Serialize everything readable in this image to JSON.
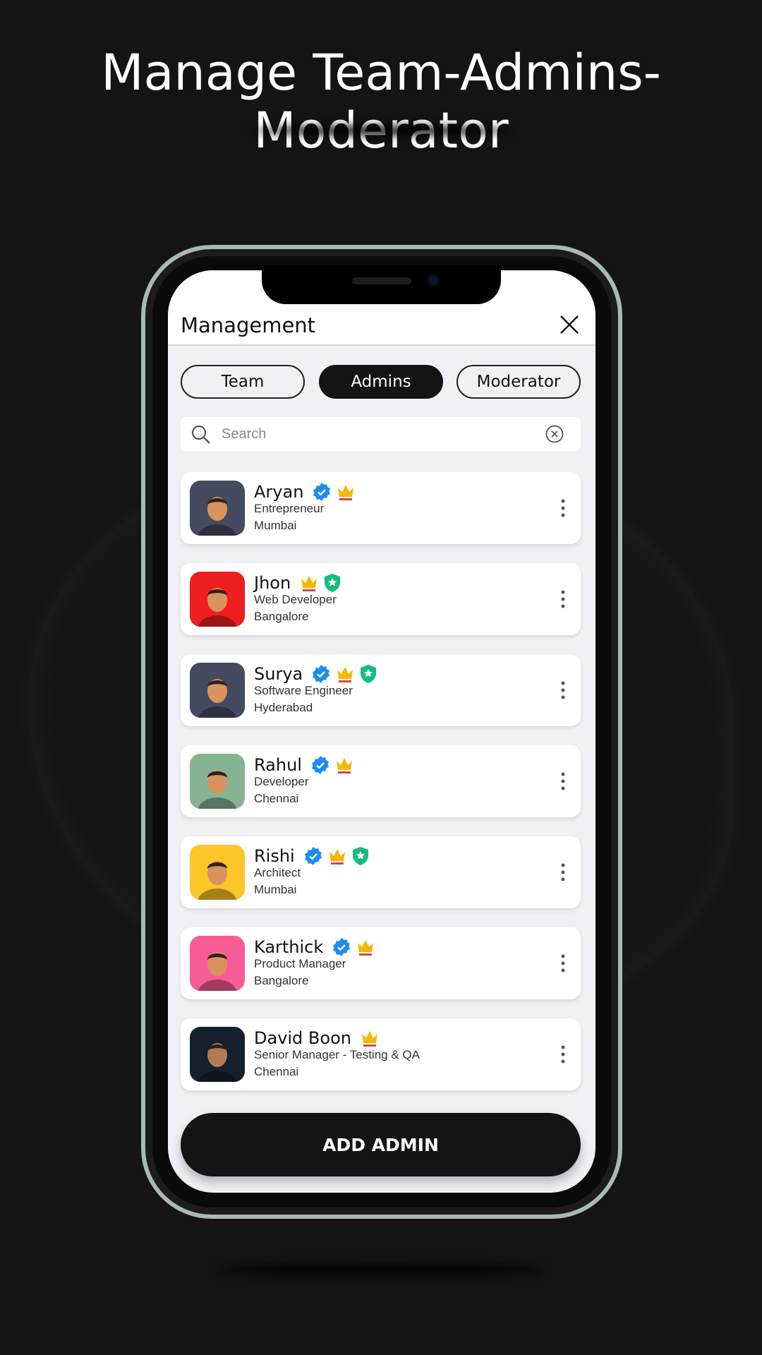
{
  "page_title": "Manage Team-Admins-Moderator",
  "header": {
    "title": "Management",
    "close_icon": "close-icon"
  },
  "tabs": [
    {
      "label": "Team",
      "active": false
    },
    {
      "label": "Admins",
      "active": true
    },
    {
      "label": "Moderator",
      "active": false
    }
  ],
  "search": {
    "placeholder": "Search",
    "value": ""
  },
  "colors": {
    "verified": "#1d8cf2",
    "crown": "#f5b800",
    "crown_bar": "#e0443a",
    "shield": "#16bd7f",
    "dark": "#141414"
  },
  "members": [
    {
      "name": "Aryan",
      "role": "Entrepreneur",
      "city": "Mumbai",
      "badges": [
        "verified",
        "crown"
      ],
      "avatar_bg": "#454b5e"
    },
    {
      "name": "Jhon",
      "role": "Web Developer",
      "city": "Bangalore",
      "badges": [
        "crown",
        "shield"
      ],
      "avatar_bg": "#ee1e1e"
    },
    {
      "name": "Surya",
      "role": "Software Engineer",
      "city": "Hyderabad",
      "badges": [
        "verified",
        "crown",
        "shield"
      ],
      "avatar_bg": "#454b5e"
    },
    {
      "name": "Rahul",
      "role": "Developer",
      "city": "Chennai",
      "badges": [
        "verified",
        "crown"
      ],
      "avatar_bg": "#86b394"
    },
    {
      "name": "Rishi",
      "role": "Architect",
      "city": "Mumbai",
      "badges": [
        "verified",
        "crown",
        "shield"
      ],
      "avatar_bg": "#fcc528"
    },
    {
      "name": "Karthick",
      "role": "Product Manager",
      "city": "Bangalore",
      "badges": [
        "verified",
        "crown"
      ],
      "avatar_bg": "#f85c96"
    },
    {
      "name": "David Boon",
      "role": "Senior Manager - Testing & QA",
      "city": "Chennai",
      "badges": [
        "crown"
      ],
      "avatar_bg": "#14202c"
    }
  ],
  "add_button": {
    "label": "ADD ADMIN"
  }
}
